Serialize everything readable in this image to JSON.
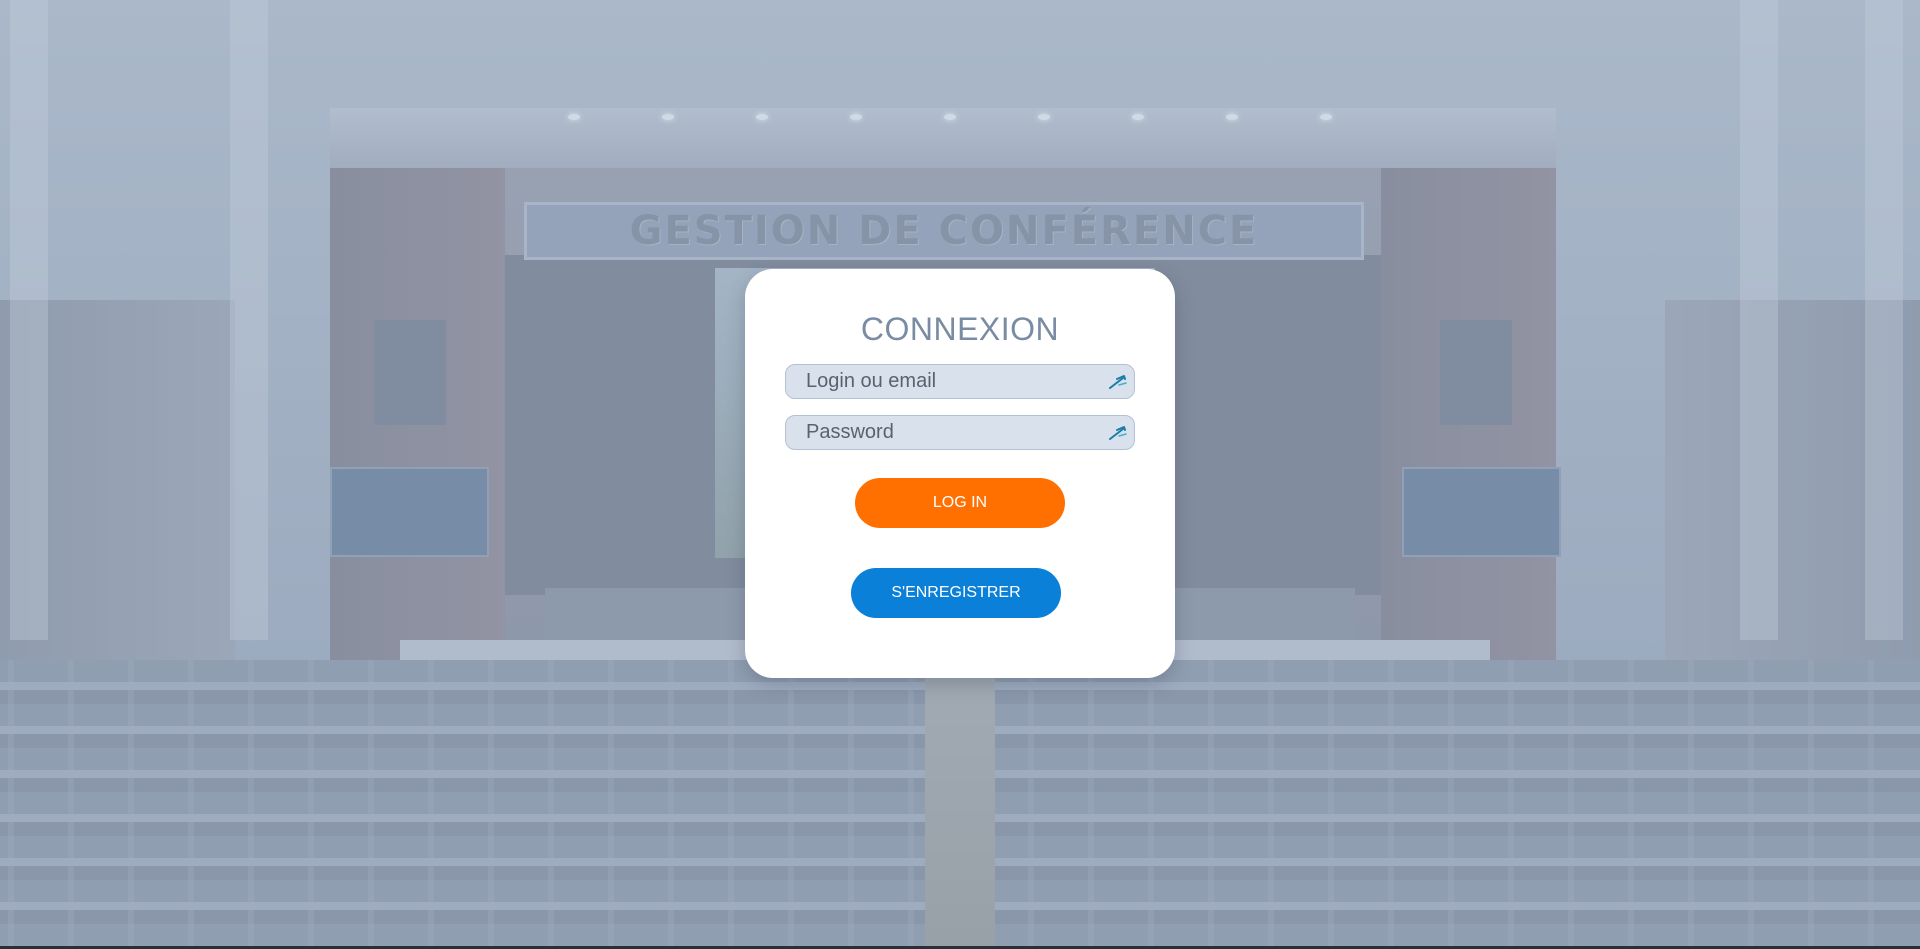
{
  "background": {
    "banner_text": "GESTION DE CONFÉRENCE"
  },
  "login_card": {
    "title": "CONNEXION",
    "login_field": {
      "placeholder": "Login ou email",
      "value": "",
      "icon": "key-icon"
    },
    "password_field": {
      "placeholder": "Password",
      "value": "",
      "icon": "key-icon"
    },
    "login_button": "LOG IN",
    "register_button": "S'ENREGISTRER"
  },
  "colors": {
    "title": "#7a8ca3",
    "field_bg": "#d9e1ec",
    "login_button": "#ff7000",
    "register_button": "#0a80d8",
    "icon": "#1a7fa8"
  }
}
